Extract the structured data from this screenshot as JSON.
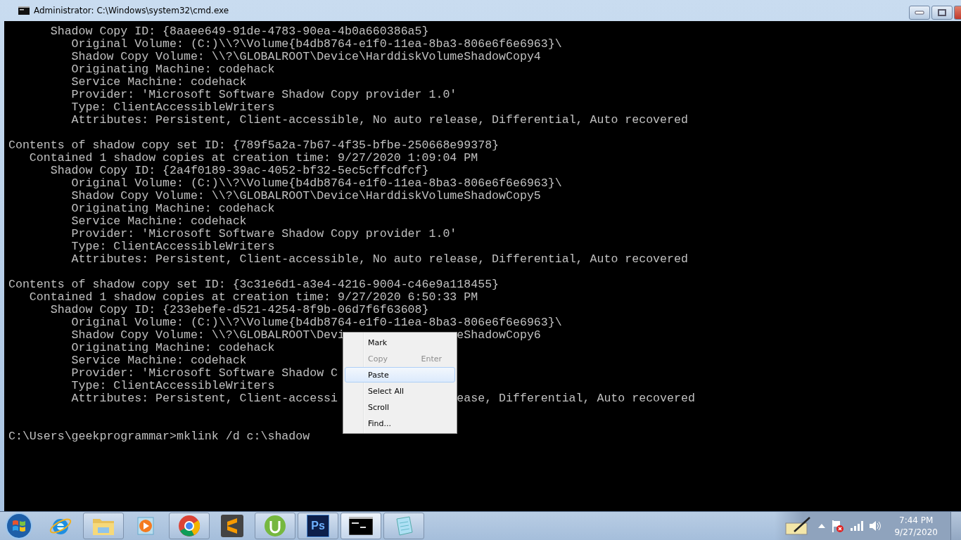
{
  "window": {
    "title": "Administrator: C:\\Windows\\system32\\cmd.exe"
  },
  "console": {
    "lines": [
      {
        "text": "      Shadow Copy ID: {8aaee649-91de-4783-90ea-4b0a660386a5}"
      },
      {
        "text": "         Original Volume: (C:)\\\\?\\Volume{b4db8764-e1f0-11ea-8ba3-806e6f6e6963}\\"
      },
      {
        "text": "         Shadow Copy Volume: \\\\?\\GLOBALROOT\\Device\\HarddiskVolumeShadowCopy4"
      },
      {
        "text": "         Originating Machine: codehack"
      },
      {
        "text": "         Service Machine: codehack"
      },
      {
        "text": "         Provider: 'Microsoft Software Shadow Copy provider 1.0'"
      },
      {
        "text": "         Type: ClientAccessibleWriters"
      },
      {
        "text": "         Attributes: Persistent, Client-accessible, No auto release, Differential, Auto recovered"
      },
      {
        "kind": "blank"
      },
      {
        "text": "Contents of shadow copy set ID: {789f5a2a-7b67-4f35-bfbe-250668e99378}"
      },
      {
        "text": "   Contained 1 shadow copies at creation time: 9/27/2020 1:09:04 PM"
      },
      {
        "text": "      Shadow Copy ID: {2a4f0189-39ac-4052-bf32-5ec5cffcdfcf}"
      },
      {
        "text": "         Original Volume: (C:)\\\\?\\Volume{b4db8764-e1f0-11ea-8ba3-806e6f6e6963}\\"
      },
      {
        "text": "         Shadow Copy Volume: \\\\?\\GLOBALROOT\\Device\\HarddiskVolumeShadowCopy5"
      },
      {
        "text": "         Originating Machine: codehack"
      },
      {
        "text": "         Service Machine: codehack"
      },
      {
        "text": "         Provider: 'Microsoft Software Shadow Copy provider 1.0'"
      },
      {
        "text": "         Type: ClientAccessibleWriters"
      },
      {
        "text": "         Attributes: Persistent, Client-accessible, No auto release, Differential, Auto recovered"
      },
      {
        "kind": "blank"
      },
      {
        "text": "Contents of shadow copy set ID: {3c31e6d1-a3e4-4216-9004-c46e9a118455}"
      },
      {
        "text": "   Contained 1 shadow copies at creation time: 9/27/2020 6:50:33 PM"
      },
      {
        "text": "      Shadow Copy ID: {233ebefe-d521-4254-8f9b-06d7f6f63608}"
      },
      {
        "text": "         Original Volume: (C:)\\\\?\\Volume{b4db8764-e1f0-11ea-8ba3-806e6f6e6963}\\"
      },
      {
        "text": "         Shadow Copy Volume: \\\\?\\GLOBALROOT\\Devi",
        "tail": "eShadowCopy6"
      },
      {
        "text": "         Originating Machine: codehack"
      },
      {
        "text": "         Service Machine: codehack"
      },
      {
        "text": "         Provider: 'Microsoft Software Shadow C"
      },
      {
        "text": "         Type: ClientAccessibleWriters"
      },
      {
        "text": "         Attributes: Persistent, Client-accessi",
        "tail": "ease, Differential, Auto recovered"
      },
      {
        "kind": "blank"
      },
      {
        "kind": "blank"
      },
      {
        "text": "C:\\Users\\geekprogrammar>mklink /d c:\\shadow"
      }
    ]
  },
  "context_menu": {
    "items": [
      {
        "label": "Mark",
        "disabled": false,
        "selected": false
      },
      {
        "label": "Copy",
        "shortcut": "Enter",
        "disabled": true,
        "selected": false
      },
      {
        "label": "Paste",
        "disabled": false,
        "selected": true
      },
      {
        "label": "Select All",
        "disabled": false,
        "selected": false
      },
      {
        "label": "Scroll",
        "disabled": false,
        "selected": false
      },
      {
        "label": "Find...",
        "disabled": false,
        "selected": false
      }
    ]
  },
  "taskbar": {
    "items": [
      {
        "kind": "ie",
        "running": false,
        "active": false
      },
      {
        "kind": "folder",
        "running": true,
        "active": false
      },
      {
        "kind": "media",
        "running": false,
        "active": false
      },
      {
        "kind": "chrome",
        "running": true,
        "active": false
      },
      {
        "kind": "sublime",
        "running": false,
        "active": false
      },
      {
        "kind": "torrent",
        "running": true,
        "active": false
      },
      {
        "kind": "photoshop",
        "label": "Ps",
        "running": true,
        "active": false
      },
      {
        "kind": "terminal",
        "running": true,
        "active": true
      },
      {
        "kind": "notepad",
        "running": true,
        "active": false
      }
    ],
    "clock": {
      "time": "7:44 PM",
      "date": "9/27/2020"
    }
  }
}
